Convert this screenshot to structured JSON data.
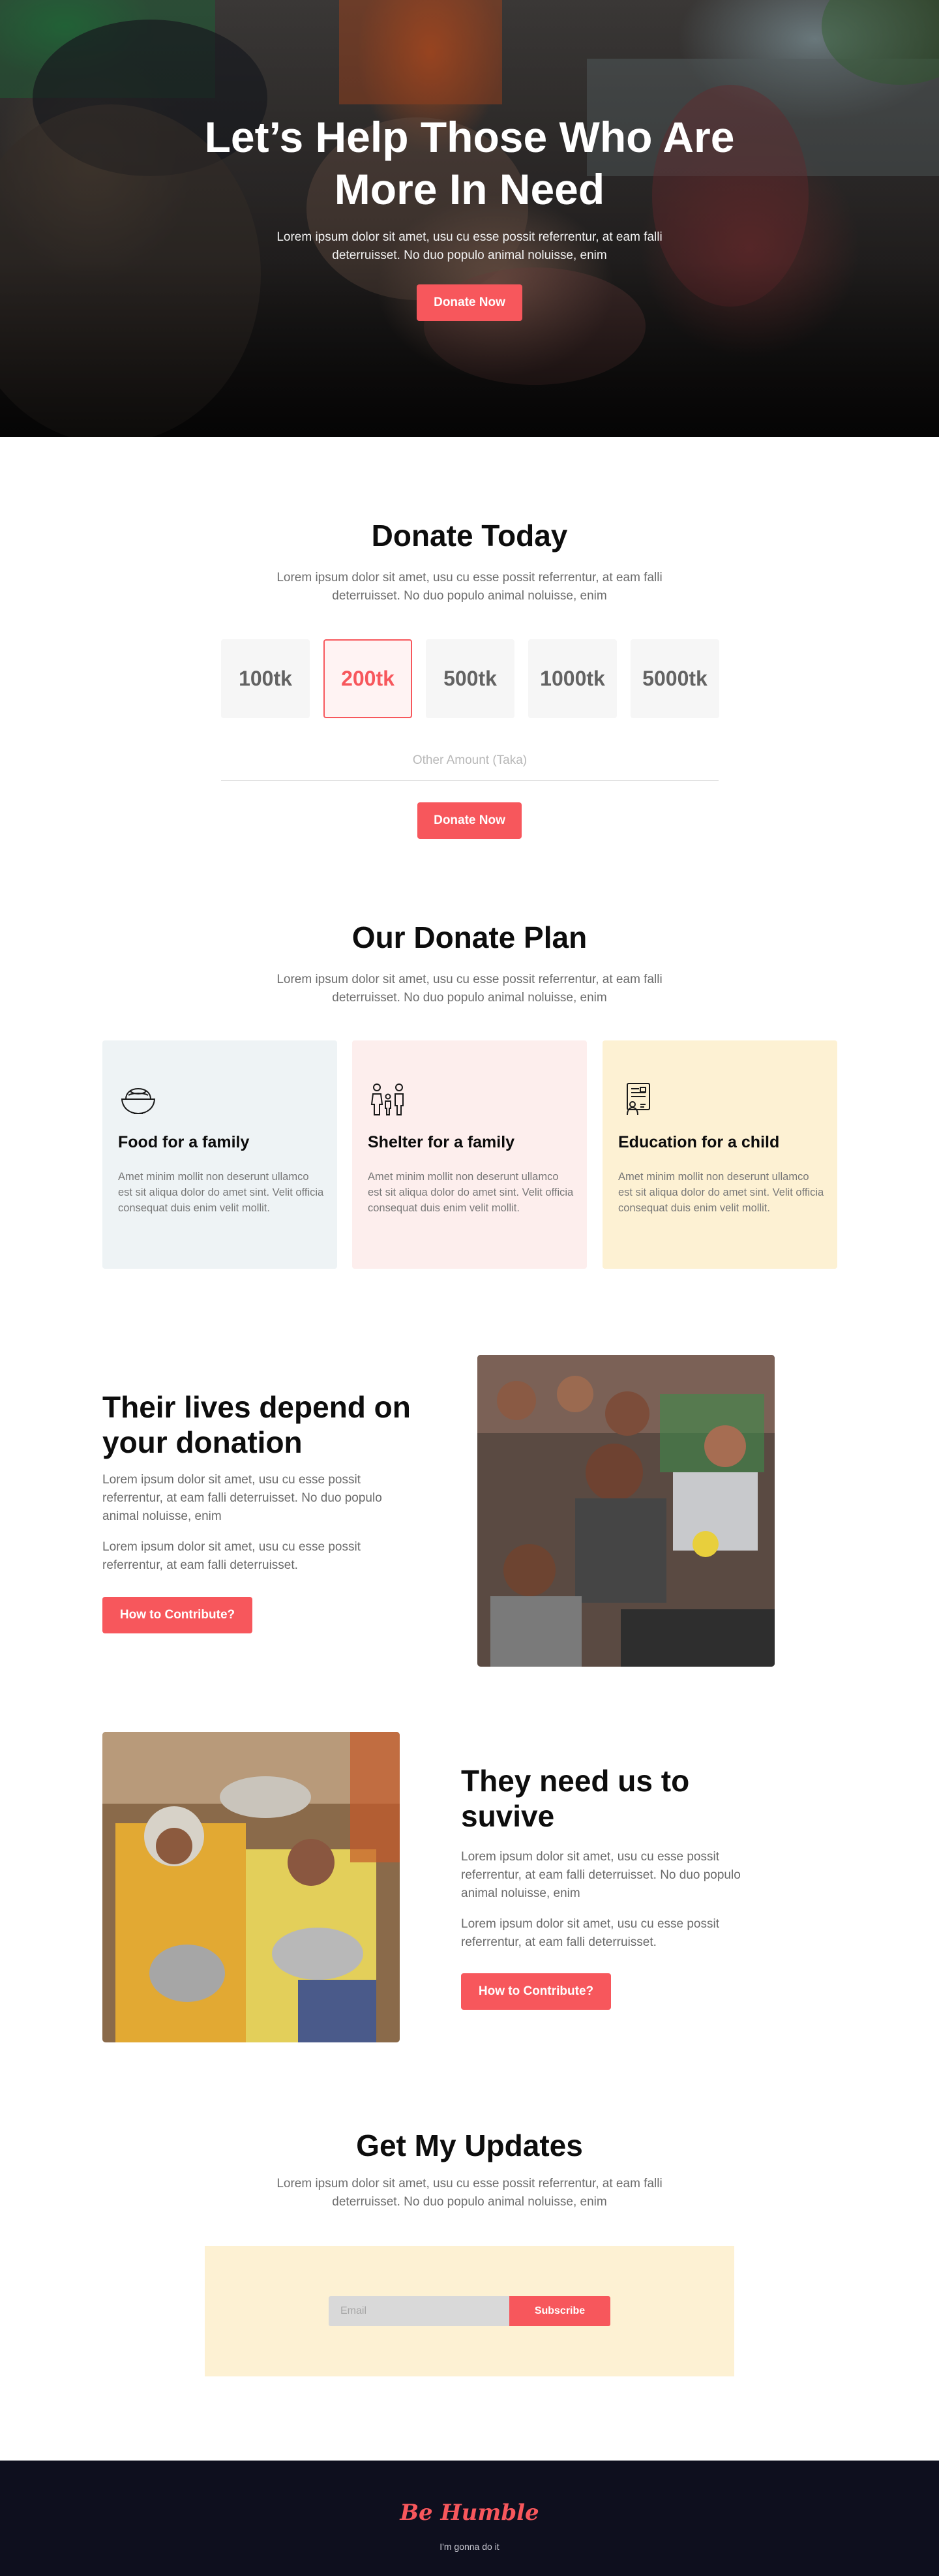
{
  "colors": {
    "accent": "#f7575c",
    "footer_bg": "#0e0f1e",
    "card_food": "#eef3f5",
    "card_shelter": "#fdeeed",
    "card_education": "#fdf1d3",
    "subscribe_box": "#fdf1d3"
  },
  "hero": {
    "title": "Let’s Help Those Who Are More In Need",
    "text": "Lorem ipsum dolor sit amet, usu cu esse possit referrentur, at eam falli deterruisset. No duo populo animal noluisse, enim",
    "button": "Donate Now"
  },
  "donate_today": {
    "title": "Donate Today",
    "text": "Lorem ipsum dolor sit amet, usu cu esse possit referrentur, at eam falli deterruisset. No duo populo animal noluisse, enim",
    "amounts": [
      "100tk",
      "200tk",
      "500tk",
      "1000tk",
      "5000tk"
    ],
    "selected": "200tk",
    "other_placeholder": "Other Amount (Taka)",
    "button": "Donate Now"
  },
  "plan": {
    "title": "Our Donate Plan",
    "text": "Lorem ipsum dolor sit amet, usu cu esse possit referrentur, at eam falli deterruisset. No duo populo animal noluisse, enim",
    "cards": [
      {
        "icon": "food-bowl-icon",
        "title": "Food for a family",
        "text": "Amet minim mollit non deserunt ullamco est sit aliqua dolor do amet sint. Velit officia consequat duis enim velit mollit."
      },
      {
        "icon": "family-icon",
        "title": "Shelter for a family",
        "text": "Amet minim mollit non deserunt ullamco est sit aliqua dolor do amet sint. Velit officia consequat duis enim velit mollit."
      },
      {
        "icon": "education-icon",
        "title": "Education for a child",
        "text": "Amet minim mollit non deserunt ullamco est sit aliqua dolor do amet sint. Velit officia consequat duis enim velit mollit."
      }
    ]
  },
  "story1": {
    "title": "Their lives depend on your donation",
    "p1": "Lorem ipsum dolor sit amet, usu cu esse possit referrentur, at eam falli deterruisset. No duo populo animal noluisse, enim",
    "p2": "Lorem ipsum dolor sit amet, usu cu esse possit referrentur, at eam falli deterruisset.",
    "button": "How to Contribute?"
  },
  "story2": {
    "title": "They need us to suvive",
    "p1": "Lorem ipsum dolor sit amet, usu cu esse possit referrentur, at eam falli deterruisset. No duo populo animal noluisse, enim",
    "p2": "Lorem ipsum dolor sit amet, usu cu esse possit referrentur, at eam falli deterruisset.",
    "button": "How to Contribute?"
  },
  "updates": {
    "title": "Get My Updates",
    "text": "Lorem ipsum dolor sit amet, usu cu esse possit referrentur, at eam falli deterruisset. No duo populo animal noluisse, enim",
    "email_placeholder": "Email",
    "button": "Subscribe"
  },
  "footer": {
    "brand": "Be Humble",
    "tagline": "I'm gonna do it"
  }
}
